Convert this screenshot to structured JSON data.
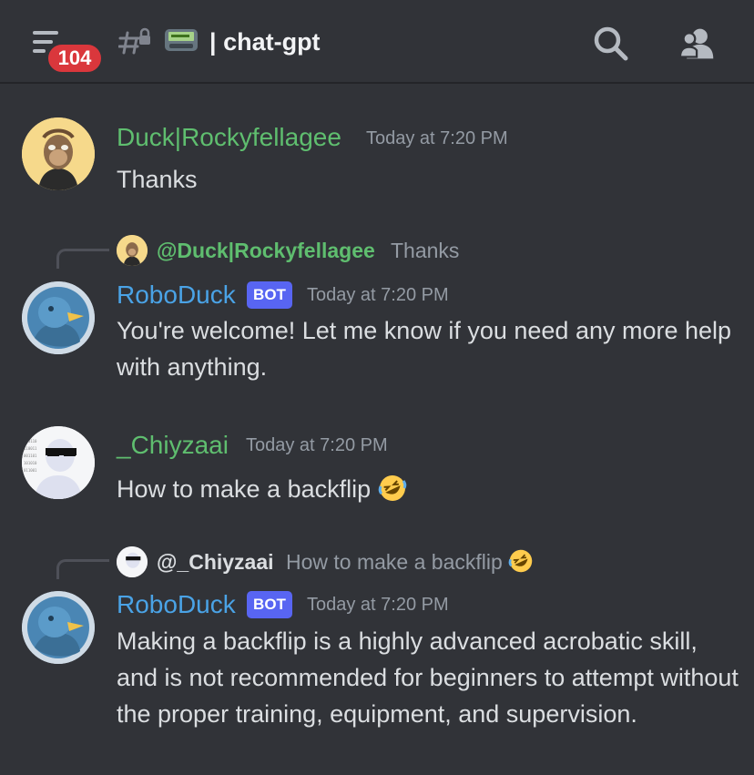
{
  "header": {
    "unread_count": "104",
    "channel_name": "chat-gpt",
    "channel_emoji": "pager-emoji"
  },
  "colors": {
    "background": "#313338",
    "green_name": "#5fbe6f",
    "bot_name": "#4aa3e6",
    "bot_tag": "#5865f2",
    "badge": "#da373c"
  },
  "messages": [
    {
      "author": "Duck|Rockyfellagee",
      "timestamp": "Today at 7:20 PM",
      "text": "Thanks"
    },
    {
      "reply_to": "@Duck|Rockyfellagee",
      "reply_text": "Thanks",
      "author": "RoboDuck",
      "tag": "BOT",
      "timestamp": "Today at 7:20 PM",
      "text": "You're welcome! Let me know if you need any more help with anything."
    },
    {
      "author": "_Chiyzaai",
      "timestamp": "Today at 7:20 PM",
      "text": "How to make a backflip"
    },
    {
      "reply_to": "@_Chiyzaai",
      "reply_text": "How to make a backflip",
      "author": "RoboDuck",
      "tag": "BOT",
      "timestamp": "Today at 7:20 PM",
      "text": "Making a backflip is a highly advanced acrobatic skill, and is not recommended for beginners to attempt without the proper training, equipment, and supervision."
    }
  ]
}
